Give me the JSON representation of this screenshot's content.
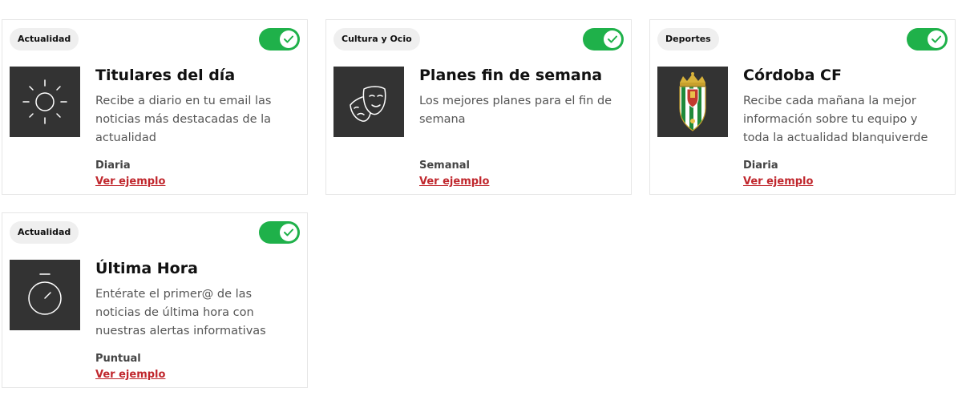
{
  "colors": {
    "toggle_on": "#1fb14a",
    "link": "#c0272d",
    "thumb_bg": "#333333",
    "tag_bg": "#efefef"
  },
  "cards": [
    {
      "tag": "Actualidad",
      "toggle_on": true,
      "icon": "sun-icon",
      "title": "Titulares del día",
      "description": "Recibe a diario en tu email las noticias más destacadas de la actualidad",
      "frequency": "Diaria",
      "link": "Ver ejemplo"
    },
    {
      "tag": "Cultura y Ocio",
      "toggle_on": true,
      "icon": "theater-masks-icon",
      "title": "Planes fin de semana",
      "description": "Los mejores planes para el fin de semana",
      "frequency": "Semanal",
      "link": "Ver ejemplo"
    },
    {
      "tag": "Deportes",
      "toggle_on": true,
      "icon": "cordoba-cf-crest-icon",
      "title": "Córdoba CF",
      "description": "Recibe cada mañana la mejor información sobre tu equipo y toda la actualidad blanquiverde",
      "frequency": "Diaria",
      "link": "Ver ejemplo"
    },
    {
      "tag": "Actualidad",
      "toggle_on": true,
      "icon": "stopwatch-icon",
      "title": "Última Hora",
      "description": "Entérate el primer@ de las noticias de última hora con nuestras alertas informativas",
      "frequency": "Puntual",
      "link": "Ver ejemplo"
    }
  ]
}
